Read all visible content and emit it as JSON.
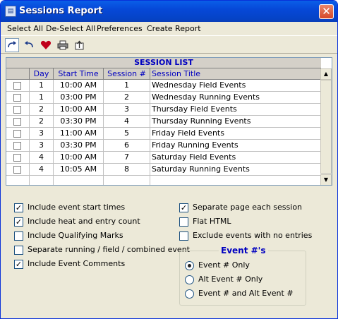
{
  "window": {
    "title": "Sessions Report",
    "close": "✕"
  },
  "menu": [
    "Select All",
    "De-Select All",
    "Preferences",
    "Create Report"
  ],
  "toolbar": [
    "redo-icon",
    "undo-icon",
    "heart-icon",
    "printer-icon",
    "export-icon"
  ],
  "grid": {
    "title": "SESSION LIST",
    "columns": [
      "Day",
      "Start Time",
      "Session #",
      "Session Title"
    ],
    "rows": [
      {
        "day": "1",
        "time": "10:00 AM",
        "session": "1",
        "title": "Wednesday Field Events"
      },
      {
        "day": "1",
        "time": "03:00 PM",
        "session": "2",
        "title": "Wednesday Running Events"
      },
      {
        "day": "2",
        "time": "10:00 AM",
        "session": "3",
        "title": "Thursday Field Events"
      },
      {
        "day": "2",
        "time": "03:30 PM",
        "session": "4",
        "title": "Thursday Running Events"
      },
      {
        "day": "3",
        "time": "11:00 AM",
        "session": "5",
        "title": "Friday Field Events"
      },
      {
        "day": "3",
        "time": "03:30 PM",
        "session": "6",
        "title": "Friday Running Events"
      },
      {
        "day": "4",
        "time": "10:00 AM",
        "session": "7",
        "title": "Saturday Field Events"
      },
      {
        "day": "4",
        "time": "10:05 AM",
        "session": "8",
        "title": "Saturday Running Events"
      }
    ]
  },
  "options_left": [
    {
      "label": "Include event start times",
      "checked": true
    },
    {
      "label": "Include heat and entry count",
      "checked": true
    },
    {
      "label": "Include Qualifying Marks",
      "checked": false
    },
    {
      "label": "Separate running / field / combined event",
      "checked": false
    },
    {
      "label": "Include Event Comments",
      "checked": true
    }
  ],
  "options_right": [
    {
      "label": "Separate page each session",
      "checked": true
    },
    {
      "label": "Flat HTML",
      "checked": false
    },
    {
      "label": "Exclude events with no entries",
      "checked": false
    }
  ],
  "event_numbers": {
    "title": "Event #'s",
    "options": [
      {
        "label": "Event # Only",
        "selected": true
      },
      {
        "label": "Alt Event # Only",
        "selected": false
      },
      {
        "label": "Event # and Alt Event #",
        "selected": false
      }
    ]
  }
}
